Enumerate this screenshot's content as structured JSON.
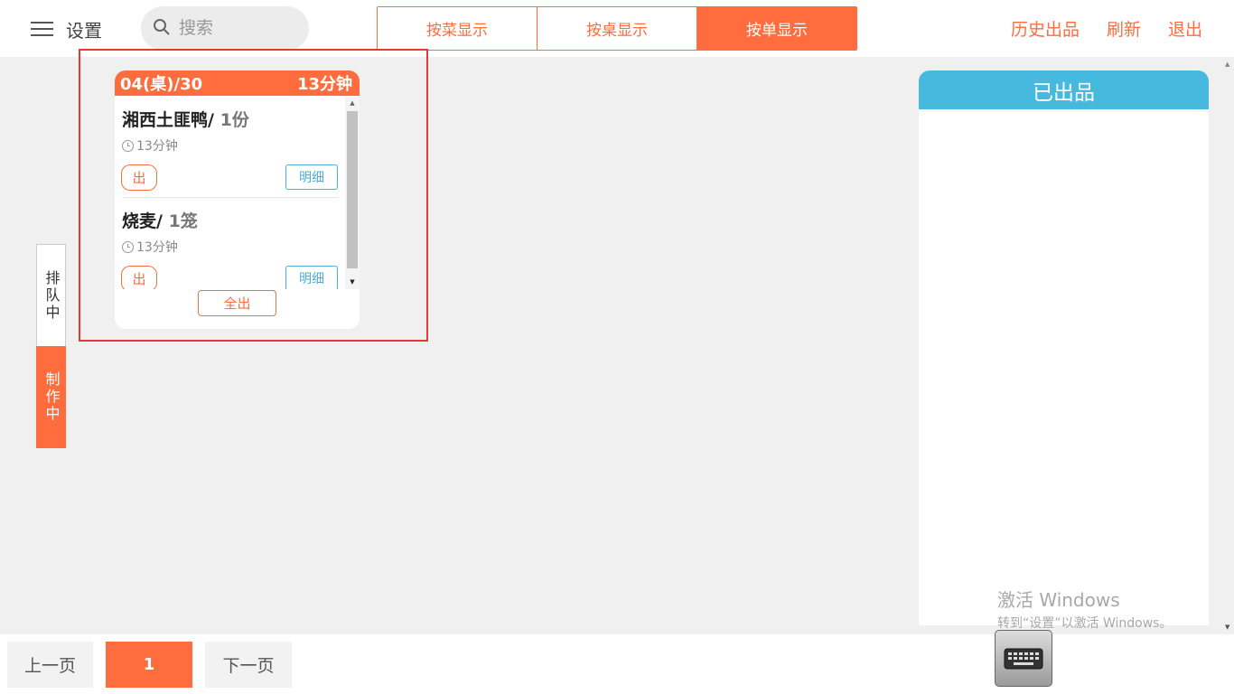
{
  "header": {
    "settings_label": "设置",
    "search_placeholder": "搜索",
    "tabs": [
      {
        "label": "按菜显示",
        "active": false
      },
      {
        "label": "按桌显示",
        "active": false
      },
      {
        "label": "按单显示",
        "active": true
      }
    ],
    "actions": [
      "历史出品",
      "刷新",
      "退出"
    ]
  },
  "side_tabs": [
    {
      "label": "排队中",
      "active": false
    },
    {
      "label": "制作中",
      "active": true
    }
  ],
  "order_card": {
    "title": "04(桌)/30",
    "elapsed": "13分钟",
    "items": [
      {
        "name": "湘西土匪鸭/",
        "qty": "1份",
        "time": "13分钟",
        "out_label": "出",
        "detail_label": "明细"
      },
      {
        "name": "烧麦/",
        "qty": "1笼",
        "time": "13分钟",
        "out_label": "出",
        "detail_label": "明细"
      }
    ],
    "all_out_label": "全出"
  },
  "served_panel": {
    "title": "已出品"
  },
  "pagination": {
    "prev_label": "上一页",
    "current": "1",
    "next_label": "下一页"
  },
  "watermark": {
    "title": "激活 Windows",
    "subtitle": "转到“设置”以激活 Windows。"
  },
  "colors": {
    "accent": "#ff6d3f",
    "served_header": "#47b9df",
    "detail_button": "#4ab0d8",
    "highlight_border": "#e03a3a"
  },
  "icons": [
    "menu-icon",
    "search-icon",
    "clock-icon",
    "keyboard-icon"
  ]
}
